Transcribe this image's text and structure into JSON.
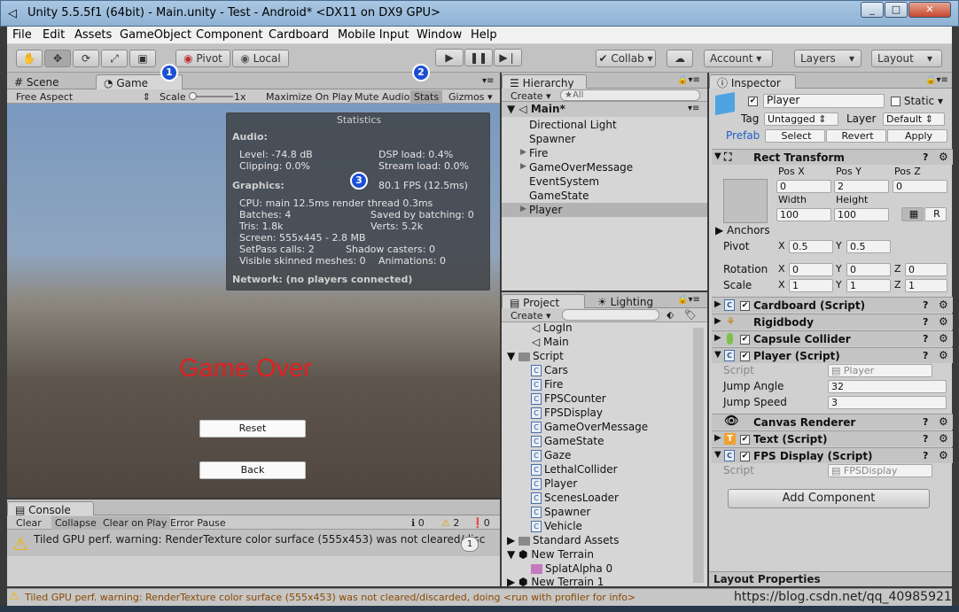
{
  "window": {
    "title": "Unity 5.5.5f1 (64bit) - Main.unity - Test - Android* <DX11 on DX9 GPU>"
  },
  "menu": [
    "File",
    "Edit",
    "Assets",
    "GameObject",
    "Component",
    "Cardboard",
    "Mobile Input",
    "Window",
    "Help"
  ],
  "toolbar": {
    "pivot": "Pivot",
    "local": "Local",
    "collab": "Collab",
    "account": "Account",
    "layers": "Layers",
    "layout": "Layout"
  },
  "tabs": {
    "scene": "Scene",
    "game": "Game",
    "hierarchy": "Hierarchy",
    "inspector": "Inspector",
    "project": "Project",
    "lighting": "Lighting",
    "console": "Console"
  },
  "gamebar": {
    "aspect": "Free Aspect",
    "scale_label": "Scale",
    "scale_value": "1x",
    "maximize": "Maximize On Play",
    "mute": "Mute Audio",
    "stats": "Stats",
    "gizmos": "Gizmos"
  },
  "game": {
    "game_over": "Game Over",
    "reset": "Reset",
    "back": "Back"
  },
  "stats": {
    "title": "Statistics",
    "audio_header": "Audio:",
    "level": "Level: -74.8 dB",
    "clipping": "Clipping: 0.0%",
    "dsp": "DSP load: 0.4%",
    "stream": "Stream load: 0.0%",
    "graphics_header": "Graphics:",
    "fps": "80.1 FPS (12.5ms)",
    "cpu": "CPU: main 12.5ms  render thread 0.3ms",
    "batches": "Batches: 4",
    "saved": "Saved by batching: 0",
    "tris": "Tris: 1.8k",
    "verts": "Verts: 5.2k",
    "screen": "Screen: 555x445 - 2.8 MB",
    "setpass": "SetPass calls: 2",
    "shadow": "Shadow casters: 0",
    "skinned": "Visible skinned meshes: 0",
    "animations": "Animations: 0",
    "network": "Network: (no players connected)"
  },
  "badges": [
    "1",
    "2",
    "3"
  ],
  "hierarchy": {
    "create": "Create",
    "search": "★All",
    "scene": "Main*",
    "items": [
      {
        "label": "Directional Light"
      },
      {
        "label": "Spawner"
      },
      {
        "label": "Fire"
      },
      {
        "label": "GameOverMessage"
      },
      {
        "label": "EventSystem"
      },
      {
        "label": "GameState"
      },
      {
        "label": "Player"
      }
    ]
  },
  "project": {
    "create": "Create",
    "items": [
      "LogIn",
      "Main",
      "Script",
      "Cars",
      "Fire",
      "FPSCounter",
      "FPSDisplay",
      "GameOverMessage",
      "GameState",
      "Gaze",
      "LethalCollider",
      "Player",
      "ScenesLoader",
      "Spawner",
      "Vehicle",
      "Standard Assets",
      "New Terrain",
      "SplatAlpha 0",
      "New Terrain 1"
    ]
  },
  "console": {
    "clear": "Clear",
    "collapse": "Collapse",
    "clear_on_play": "Clear on Play",
    "error_pause": "Error Pause",
    "info_count": "0",
    "warn_count": "2",
    "error_count": "0",
    "message": "Tiled GPU perf. warning: RenderTexture color surface  (555x453) was not cleared/discar",
    "count": "1"
  },
  "inspector": {
    "name": "Player",
    "static": "Static",
    "tag_label": "Tag",
    "tag": "Untagged",
    "layer_label": "Layer",
    "layer": "Default",
    "prefab": "Prefab",
    "select": "Select",
    "revert": "Revert",
    "apply": "Apply",
    "rect_transform": "Rect Transform",
    "posx_label": "Pos X",
    "posy_label": "Pos Y",
    "posz_label": "Pos Z",
    "posx": "0",
    "posy": "2",
    "posz": "0",
    "width_label": "Width",
    "height_label": "Height",
    "width": "100",
    "height": "100",
    "r": "R",
    "anchors": "Anchors",
    "pivot_label": "Pivot",
    "pivot_x": "0.5",
    "pivot_y": "0.5",
    "rotation_label": "Rotation",
    "rot_x": "0",
    "rot_y": "0",
    "rot_z": "0",
    "scale_label": "Scale",
    "scale_x": "1",
    "scale_y": "1",
    "scale_z": "1",
    "x": "X",
    "y": "Y",
    "z": "Z",
    "components": [
      "Cardboard (Script)",
      "Rigidbody",
      "Capsule Collider",
      "Player (Script)",
      "Canvas Renderer",
      "Text (Script)",
      "FPS Display (Script)"
    ],
    "player_script_label": "Script",
    "player_script": "Player",
    "jump_angle_label": "Jump Angle",
    "jump_angle": "32",
    "jump_speed_label": "Jump Speed",
    "jump_speed": "3",
    "fps_script_label": "Script",
    "fps_script": "FPSDisplay",
    "add_component": "Add Component",
    "layout_props": "Layout Properties"
  },
  "status": {
    "message": "Tiled GPU perf. warning: RenderTexture color surface  (555x453) was not cleared/discarded, doing <run with profiler for info>",
    "watermark": "https://blog.csdn.net/qq_40985921"
  },
  "colors": {
    "game_over": "#e02020",
    "badge": "#1c4fd6",
    "warning": "#f0b400",
    "prefab": "#1e5fc8"
  }
}
